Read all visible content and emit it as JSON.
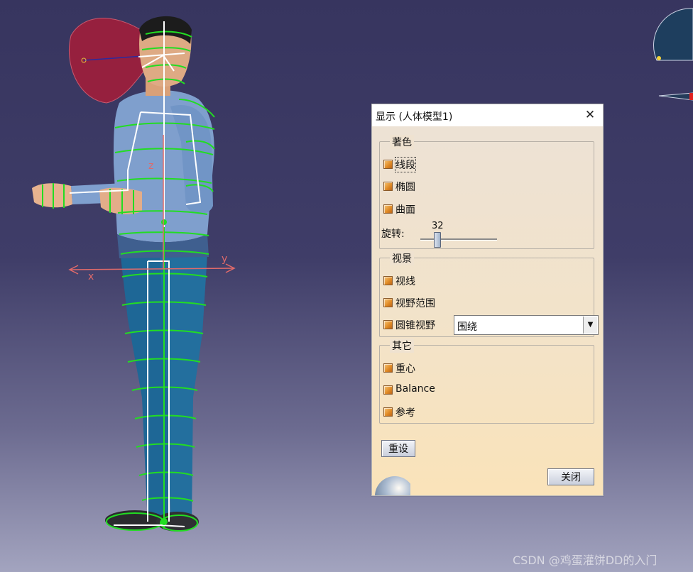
{
  "dialog": {
    "title": "显示 (人体模型1)",
    "close_glyph": "✕",
    "groups": {
      "shading": {
        "label": "著色",
        "options": [
          "线段",
          "椭圆",
          "曲面"
        ],
        "rotation_label": "旋转:",
        "rotation_value": "32"
      },
      "vision": {
        "label": "视景",
        "options": [
          "视线",
          "视野范围",
          "圆锥视野"
        ],
        "cone_select_value": "围绕"
      },
      "other": {
        "label": "其它",
        "options": [
          "重心",
          "Balance",
          "参考"
        ]
      }
    },
    "reset_button": "重设",
    "close_button": "关闭"
  },
  "viewport": {
    "axis_x": "x",
    "axis_y": "y",
    "axis_z": "z"
  },
  "watermark": "CSDN @鸡蛋灌饼DD的入门",
  "colors": {
    "checkbox": "#e08a25",
    "wireframe": "#22dd22",
    "skeleton": "#ffffff",
    "shirt": "#7f9fcd",
    "pants": "#1f6a96",
    "vision_cone": "#a0203a"
  }
}
